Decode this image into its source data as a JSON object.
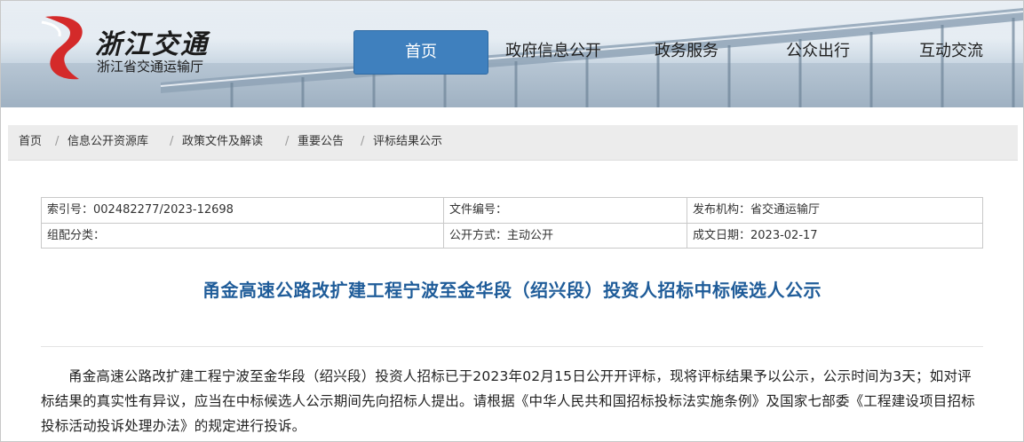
{
  "site": {
    "logo_script": "浙江交通",
    "logo_name": "浙江省交通运输厅"
  },
  "nav": {
    "items": [
      {
        "label": "首页",
        "active": true
      },
      {
        "label": "政府信息公开",
        "active": false
      },
      {
        "label": "政务服务",
        "active": false
      },
      {
        "label": "公众出行",
        "active": false
      },
      {
        "label": "互动交流",
        "active": false
      }
    ]
  },
  "breadcrumb": [
    "首页",
    "信息公开资源库",
    "政策文件及解读",
    "重要公告",
    "评标结果公示"
  ],
  "breadcrumb_separator": "/",
  "meta": {
    "index_no": "索引号：002482277/2023-12698",
    "doc_no": "文件编号：",
    "publisher": "发布机构：省交通运输厅",
    "category": "组配分类：",
    "open_mode": "公开方式：主动公开",
    "date": "成文日期：2023-02-17"
  },
  "article": {
    "title": "甬金高速公路改扩建工程宁波至金华段（绍兴段）投资人招标中标候选人公示",
    "paragraph": "甬金高速公路改扩建工程宁波至金华段（绍兴段）投资人招标已于2023年02月15日公开开评标，现将评标结果予以公示，公示时间为3天；如对评标结果的真实性有异议，应当在中标候选人公示期间先向招标人提出。请根据《中华人民共和国招标投标法实施条例》及国家七部委《工程建设项目招标投标活动投诉处理办法》的规定进行投诉。"
  },
  "colors": {
    "nav_active": "#3f80be",
    "title": "#1f5c99",
    "logo_red": "#d42a2a"
  }
}
